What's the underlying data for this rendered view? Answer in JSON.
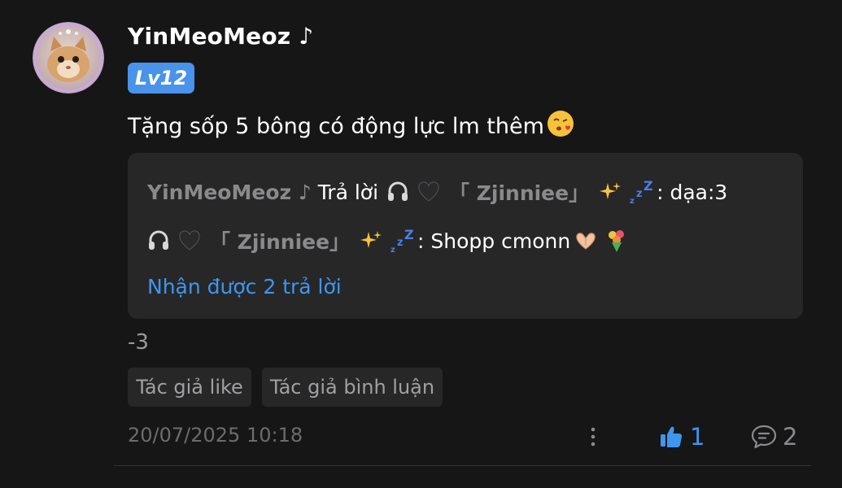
{
  "comment": {
    "username": "YinMeoMeoz ♪",
    "level": "Lv12",
    "text": "Tặng sốp 5 bông có động lực lm thêm",
    "text_emoji": "kissing-face-emoji",
    "extra": "-3",
    "timestamp": "20/07/2025 10:18",
    "likes": "1",
    "comments": "2"
  },
  "replies": {
    "reply1": {
      "author": "YinMeoMeoz ♪",
      "action": "Trả lời",
      "target_name": "「 Zjinniee」",
      "text": ": dạa:3"
    },
    "reply2": {
      "author_name": "「 Zjinniee」",
      "text": ": Shopp cmonn"
    },
    "more_link": "Nhận được 2 trả lời"
  },
  "tags": [
    "Tác giả like",
    "Tác giả bình luận"
  ],
  "colors": {
    "background": "#161617",
    "card": "#272728",
    "accent_blue": "#3e96ee",
    "badge_blue": "#4a93ea",
    "muted_gray": "#8a8a8c"
  },
  "icons": [
    "avatar-cat",
    "headphones-icon",
    "black-heart-icon",
    "sparkles-icon",
    "zzz-icon",
    "heart-hands-icon",
    "bouquet-icon",
    "more-vertical-icon",
    "thumbs-up-icon",
    "comment-bubble-icon"
  ]
}
